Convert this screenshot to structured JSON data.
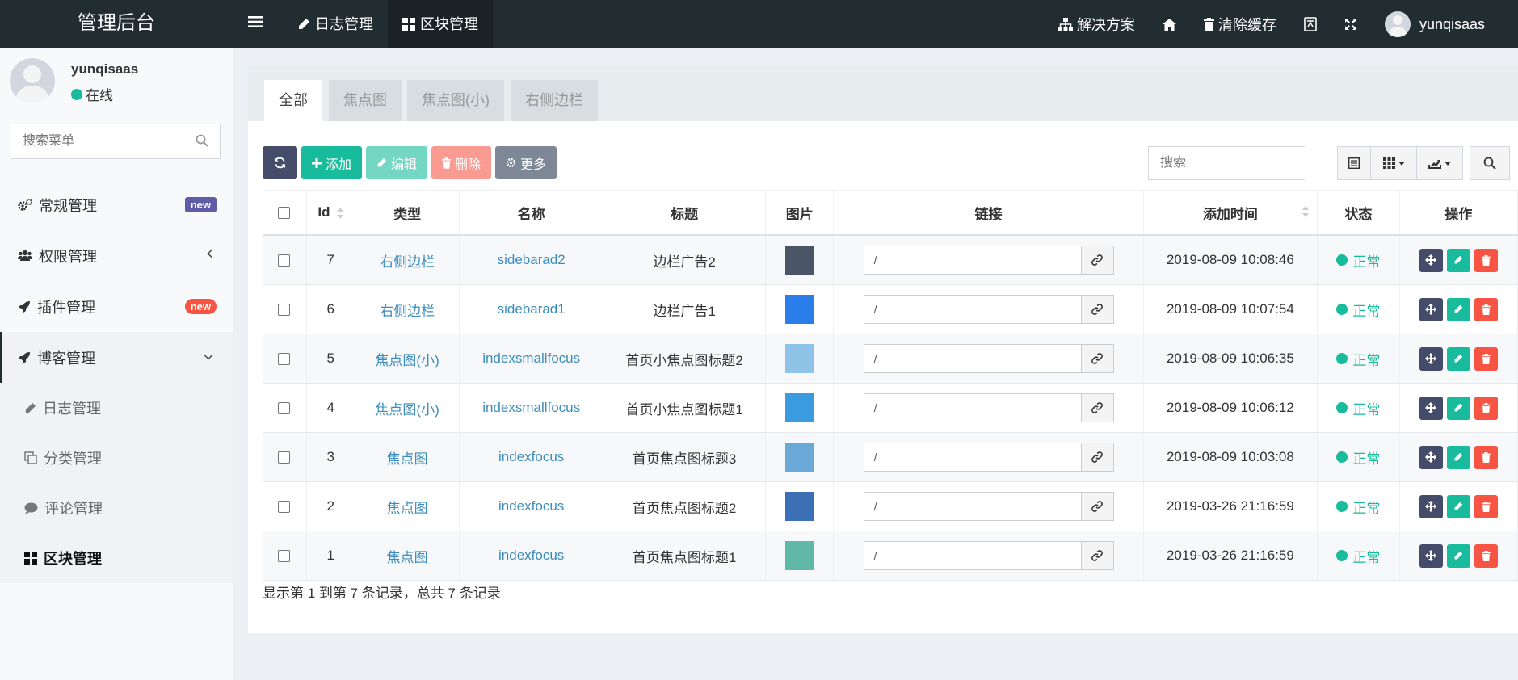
{
  "header": {
    "logo": "管理后台",
    "nav": [
      {
        "label": "日志管理",
        "icon": "pencil-icon"
      },
      {
        "label": "区块管理",
        "icon": "grid-icon",
        "active": true
      }
    ],
    "right": {
      "solutions": "解决方案",
      "clear_cache": "清除缓存",
      "username": "yunqisaas"
    }
  },
  "sidebar": {
    "user": {
      "name": "yunqisaas",
      "status": "在线"
    },
    "search_placeholder": "搜索菜单",
    "menu": [
      {
        "label": "常规管理",
        "icon": "cogs-icon",
        "badge": "new"
      },
      {
        "label": "权限管理",
        "icon": "users-icon"
      },
      {
        "label": "插件管理",
        "icon": "rocket-icon",
        "badge": "new"
      },
      {
        "label": "博客管理",
        "icon": "rocket-icon",
        "open": true
      }
    ],
    "submenu": [
      {
        "label": "日志管理",
        "icon": "pencil-icon"
      },
      {
        "label": "分类管理",
        "icon": "copy-icon"
      },
      {
        "label": "评论管理",
        "icon": "comment-icon"
      },
      {
        "label": "区块管理",
        "icon": "grid-icon",
        "active": true
      }
    ]
  },
  "tabs": [
    "全部",
    "焦点图",
    "焦点图(小)",
    "右侧边栏"
  ],
  "toolbar": {
    "add": "添加",
    "edit": "编辑",
    "delete": "删除",
    "more": "更多",
    "search_placeholder": "搜索"
  },
  "table": {
    "columns": [
      "Id",
      "类型",
      "名称",
      "标题",
      "图片",
      "链接",
      "添加时间",
      "状态",
      "操作"
    ],
    "rows": [
      {
        "id": "7",
        "type": "右侧边栏",
        "name": "sidebarad2",
        "title": "边栏广告2",
        "url": "/",
        "time": "2019-08-09 10:08:46",
        "status": "正常",
        "thumb_color": "#4a5568"
      },
      {
        "id": "6",
        "type": "右侧边栏",
        "name": "sidebarad1",
        "title": "边栏广告1",
        "url": "/",
        "time": "2019-08-09 10:07:54",
        "status": "正常",
        "thumb_color": "#2b7de9"
      },
      {
        "id": "5",
        "type": "焦点图(小)",
        "name": "indexsmallfocus",
        "title": "首页小焦点图标题2",
        "url": "/",
        "time": "2019-08-09 10:06:35",
        "status": "正常",
        "thumb_color": "#8fc4e8"
      },
      {
        "id": "4",
        "type": "焦点图(小)",
        "name": "indexsmallfocus",
        "title": "首页小焦点图标题1",
        "url": "/",
        "time": "2019-08-09 10:06:12",
        "status": "正常",
        "thumb_color": "#3a9be0"
      },
      {
        "id": "3",
        "type": "焦点图",
        "name": "indexfocus",
        "title": "首页焦点图标题3",
        "url": "/",
        "time": "2019-08-09 10:03:08",
        "status": "正常",
        "thumb_color": "#6aa8d8"
      },
      {
        "id": "2",
        "type": "焦点图",
        "name": "indexfocus",
        "title": "首页焦点图标题2",
        "url": "/",
        "time": "2019-03-26 21:16:59",
        "status": "正常",
        "thumb_color": "#3b6fb6"
      },
      {
        "id": "1",
        "type": "焦点图",
        "name": "indexfocus",
        "title": "首页焦点图标题1",
        "url": "/",
        "time": "2019-03-26 21:16:59",
        "status": "正常",
        "thumb_color": "#5fb8a8"
      }
    ]
  },
  "pagination_info": "显示第 1 到第 7 条记录，总共 7 条记录",
  "colors": {
    "accent": "#18bc9c",
    "dark": "#222d32",
    "danger": "#f75444",
    "link": "#3c8dbc"
  }
}
